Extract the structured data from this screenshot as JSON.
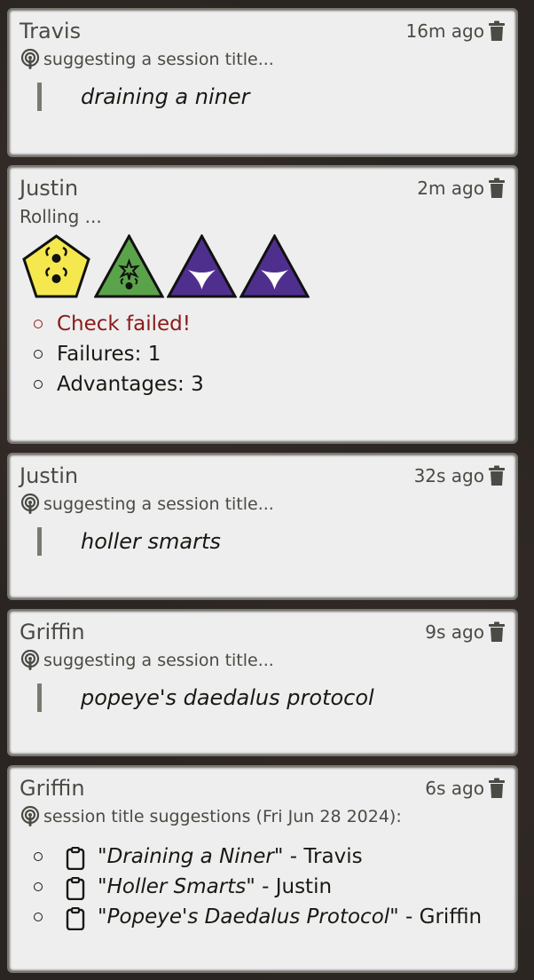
{
  "messages": [
    {
      "speaker": "Travis",
      "time": "16m ago",
      "flavor": "suggesting a session title...",
      "quote": "draining a niner"
    },
    {
      "speaker": "Justin",
      "time": "2m ago",
      "flavor": "Rolling ...",
      "dice": [
        {
          "shape": "pentagon",
          "color": "#f5e84f",
          "icon": "success-success-icon"
        },
        {
          "shape": "triangle",
          "color": "#5aa34a",
          "icon": "triumph-success-icon"
        },
        {
          "shape": "triangle",
          "color": "#4f2f8e",
          "icon": "advantage-icon"
        },
        {
          "shape": "triangle",
          "color": "#4f2f8e",
          "icon": "advantage-icon"
        }
      ],
      "results": [
        "Check failed!",
        "Failures: 1",
        "Advantages: 3"
      ]
    },
    {
      "speaker": "Justin",
      "time": "32s ago",
      "flavor": "suggesting a session title...",
      "quote": "holler smarts"
    },
    {
      "speaker": "Griffin",
      "time": "9s ago",
      "flavor": "suggesting a session title...",
      "quote": "popeye's daedalus protocol"
    },
    {
      "speaker": "Griffin",
      "time": "6s ago",
      "flavor": "session title suggestions (Fri Jun 28 2024):",
      "suggestions": [
        {
          "title": "\"Draining a Niner\"",
          "by": " - Travis"
        },
        {
          "title": "\"Holler Smarts\"",
          "by": " - Justin"
        },
        {
          "title": "\"Popeye's Daedalus Protocol\"",
          "by": " - Griffin"
        }
      ]
    }
  ],
  "colors": {
    "card_bg": "#eeeeee",
    "card_border": "#7a7971",
    "failure_text": "#8b1a1a"
  }
}
